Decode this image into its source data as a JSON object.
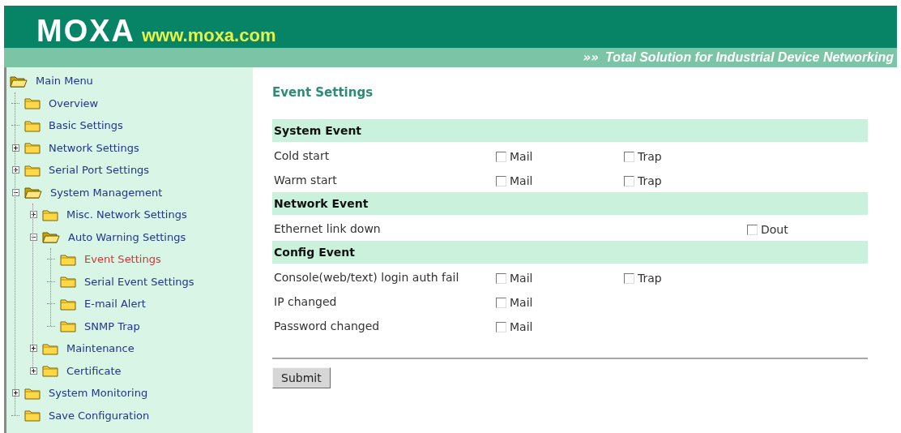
{
  "header": {
    "logo": "MOXA",
    "url": "www.moxa.com",
    "slogan_mark": "»»",
    "slogan": "Total Solution for Industrial Device Networking"
  },
  "sidebar": {
    "tree": [
      {
        "label": "Main Menu",
        "expanded": true,
        "selected": false,
        "children": [
          {
            "label": "Overview",
            "selected": false
          },
          {
            "label": "Basic Settings",
            "selected": false
          },
          {
            "label": "Network Settings",
            "expanded": false,
            "selected": false
          },
          {
            "label": "Serial Port Settings",
            "expanded": false,
            "selected": false
          },
          {
            "label": "System Management",
            "expanded": true,
            "selected": false,
            "children": [
              {
                "label": "Misc. Network Settings",
                "expanded": false,
                "selected": false
              },
              {
                "label": "Auto Warning Settings",
                "expanded": true,
                "selected": false,
                "children": [
                  {
                    "label": "Event Settings",
                    "selected": true
                  },
                  {
                    "label": "Serial Event Settings",
                    "selected": false
                  },
                  {
                    "label": "E-mail Alert",
                    "selected": false
                  },
                  {
                    "label": "SNMP Trap",
                    "selected": false
                  }
                ]
              },
              {
                "label": "Maintenance",
                "expanded": false,
                "selected": false
              },
              {
                "label": "Certificate",
                "expanded": false,
                "selected": false
              }
            ]
          },
          {
            "label": "System Monitoring",
            "expanded": false,
            "selected": false
          },
          {
            "label": "Save Configuration",
            "selected": false
          }
        ]
      }
    ]
  },
  "content": {
    "title": "Event Settings",
    "sections": [
      {
        "title": "System Event",
        "rows": [
          {
            "label": "Cold start",
            "options": [
              {
                "kind": "mail",
                "label": "Mail",
                "checked": false
              },
              {
                "kind": "trap",
                "label": "Trap",
                "checked": false
              }
            ]
          },
          {
            "label": "Warm start",
            "options": [
              {
                "kind": "mail",
                "label": "Mail",
                "checked": false
              },
              {
                "kind": "trap",
                "label": "Trap",
                "checked": false
              }
            ]
          }
        ]
      },
      {
        "title": "Network Event",
        "rows": [
          {
            "label": "Ethernet link down",
            "options": [
              {
                "kind": "dout",
                "label": "Dout",
                "checked": false
              }
            ]
          }
        ]
      },
      {
        "title": "Config Event",
        "rows": [
          {
            "label": "Console(web/text) login auth fail",
            "options": [
              {
                "kind": "mail",
                "label": "Mail",
                "checked": false
              },
              {
                "kind": "trap",
                "label": "Trap",
                "checked": false
              }
            ]
          },
          {
            "label": "IP changed",
            "options": [
              {
                "kind": "mail",
                "label": "Mail",
                "checked": false
              }
            ]
          },
          {
            "label": "Password changed",
            "options": [
              {
                "kind": "mail",
                "label": "Mail",
                "checked": false
              }
            ]
          }
        ]
      }
    ],
    "submit": "Submit"
  }
}
